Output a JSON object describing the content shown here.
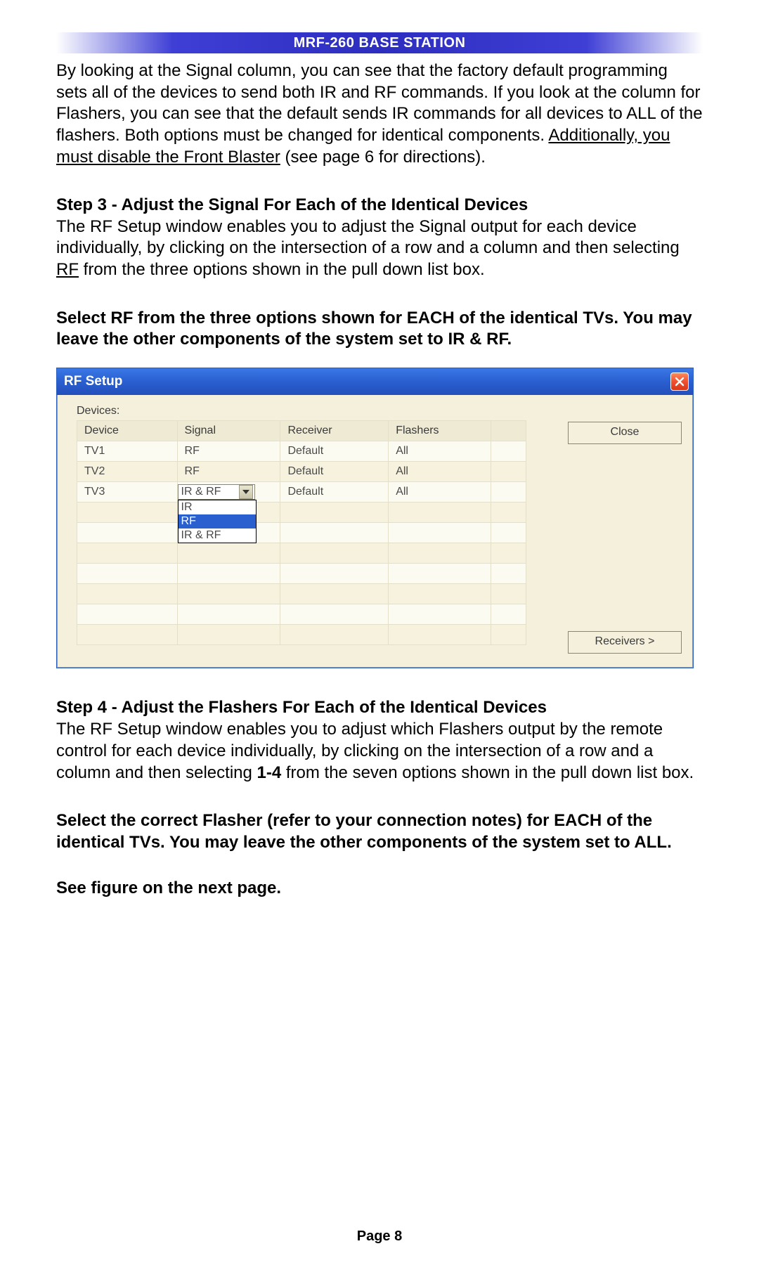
{
  "header": {
    "title_strong": "MRF-260 B",
    "title_sc": "ASE",
    "title_sp": " S",
    "title_sc2": "TATION"
  },
  "header_full": "MRF-260 BASE STATION",
  "para1_a": "By looking at the Signal column, you can see that the factory default programming sets all of the devices to send both IR and RF commands.  If you look at the column for Flashers, you can see that the default sends IR commands for all devices to ALL of the flashers. Both options must be changed for identical components. ",
  "para1_u": "Additionally, you must disable the Front Blaster",
  "para1_b": " (see page 6 for directions).",
  "step3_heading": "Step 3 - Adjust the Signal For Each of the Identical Devices",
  "step3_body_a": "The RF Setup window enables you to adjust the Signal output for each device individually, by clicking on the intersection of a row and a column and then selecting ",
  "step3_body_u": "RF",
  "step3_body_b": " from the three options shown in the pull down list box.",
  "step3_bold": "Select RF from the three options shown for EACH of the identical TVs. You may leave the other components of the system set to IR & RF.",
  "rf_window": {
    "title": "RF Setup",
    "devices_label": "Devices:",
    "columns": [
      "Device",
      "Signal",
      "Receiver",
      "Flashers"
    ],
    "rows": [
      {
        "device": "TV1",
        "signal": "RF",
        "receiver": "Default",
        "flashers": "All"
      },
      {
        "device": "TV2",
        "signal": "RF",
        "receiver": "Default",
        "flashers": "All"
      },
      {
        "device": "TV3",
        "signal": "IR & RF",
        "receiver": "Default",
        "flashers": "All",
        "dropdown_open": true
      }
    ],
    "dropdown_options": [
      "IR",
      "RF",
      "IR & RF"
    ],
    "dropdown_highlight_index": 1,
    "close_button": "Close",
    "receivers_button": "Receivers >"
  },
  "step4_heading": "Step 4 - Adjust the Flashers For Each of the Identical Devices",
  "step4_body_a": "The RF Setup window enables you to adjust which Flashers output by the remote control for each device individually, by clicking on the intersection of a row and a column and then selecting ",
  "step4_body_strong": "1-4",
  "step4_body_b": "  from the seven options shown in the pull down list box.",
  "step4_bold": "Select the correct Flasher (refer to your connection notes) for EACH of the identical TVs. You may leave the other components of the system set to ALL.",
  "see_next": "See figure on the next page.",
  "page_number": "Page 8"
}
